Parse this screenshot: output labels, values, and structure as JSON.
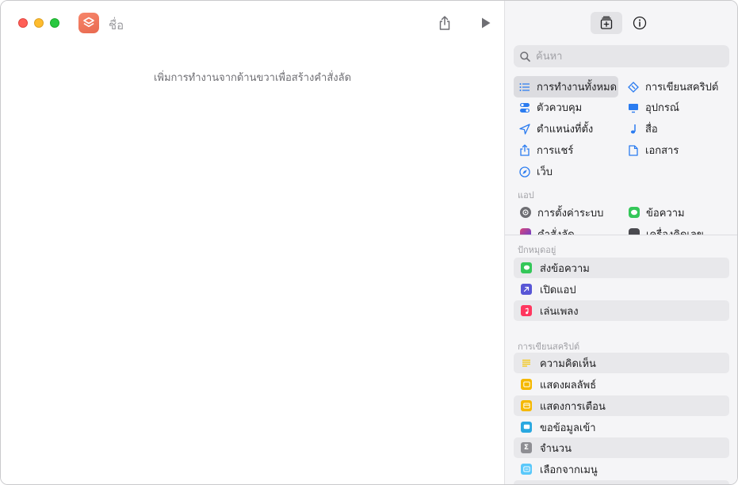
{
  "window": {
    "title": "ชื่อ"
  },
  "editor": {
    "placeholder": "เพิ่มการทำงานจากด้านขวาเพื่อสร้างคำสั่งลัด"
  },
  "search": {
    "placeholder": "ค้นหา"
  },
  "categories": [
    {
      "label": "การทำงานทั้งหมด",
      "icon": "list-icon",
      "selected": true
    },
    {
      "label": "การเขียนสคริปต์",
      "icon": "scripting-icon"
    },
    {
      "label": "ตัวควบคุม",
      "icon": "toggles-icon"
    },
    {
      "label": "อุปกรณ์",
      "icon": "display-icon"
    },
    {
      "label": "ตำแหน่งที่ตั้ง",
      "icon": "location-arrow-icon"
    },
    {
      "label": "สื่อ",
      "icon": "music-note-icon"
    },
    {
      "label": "การแชร์",
      "icon": "share-icon"
    },
    {
      "label": "เอกสาร",
      "icon": "document-icon"
    },
    {
      "label": "เว็บ",
      "icon": "compass-icon"
    }
  ],
  "apps": {
    "label": "แอป",
    "items": [
      {
        "label": "การตั้งค่าระบบ",
        "icon": "system-settings-icon"
      },
      {
        "label": "ข้อความ",
        "icon": "messages-icon"
      },
      {
        "label": "คำสั่งลัด",
        "icon": "shortcuts-icon"
      },
      {
        "label": "เครื่องคิดเลข",
        "icon": "calculator-icon"
      }
    ]
  },
  "pinned": {
    "label": "ปักหมุดอยู่",
    "items": [
      {
        "label": "ส่งข้อความ",
        "icon": "messages-icon",
        "color": "#34c759"
      },
      {
        "label": "เปิดแอป",
        "icon": "open-app-icon",
        "color": "#5856d6"
      },
      {
        "label": "เล่นเพลง",
        "icon": "music-icon",
        "color": "#ff375f"
      }
    ]
  },
  "scripting": {
    "label": "การเขียนสคริปต์",
    "items": [
      {
        "label": "ความคิดเห็น",
        "icon": "comment-lines-icon",
        "color": "#f5c400"
      },
      {
        "label": "แสดงผลลัพธ์",
        "icon": "show-result-icon",
        "color": "#f5b800"
      },
      {
        "label": "แสดงการเตือน",
        "icon": "alert-icon",
        "color": "#f5b800"
      },
      {
        "label": "ขอข้อมูลเข้า",
        "icon": "ask-input-icon",
        "color": "#2aa8e0"
      },
      {
        "label": "จำนวน",
        "icon": "sigma-icon",
        "color": "#8e8e93"
      },
      {
        "label": "เลือกจากเมนู",
        "icon": "menu-icon",
        "color": "#5ac8fa"
      }
    ]
  }
}
